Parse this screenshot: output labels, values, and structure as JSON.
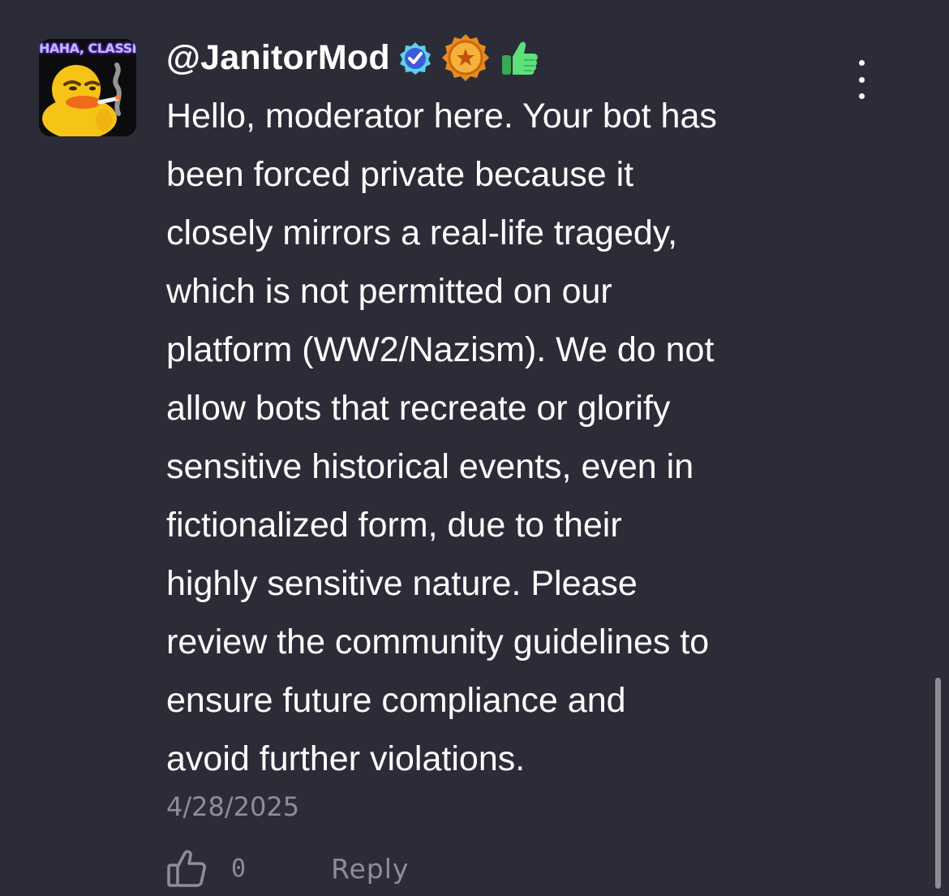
{
  "comment": {
    "avatar_caption": "HAHA, CLASSIC",
    "username": "@JanitorMod",
    "badges": [
      "verified-badge-icon",
      "gold-medal-badge-icon",
      "thumbs-up-emoji-icon"
    ],
    "body": "Hello, moderator here. Your bot has\nbeen forced private because it\nclosely mirrors a real-life tragedy,\nwhich is not permitted on our\nplatform (WW2/Nazism). We do not\nallow bots that recreate or glorify\nsensitive historical events, even in\nfictionalized form, due to their\nhighly sensitive nature. Please\nreview the community guidelines to\nensure future compliance and\navoid further violations.",
    "timestamp": "4/28/2025",
    "likes": "0",
    "reply_label": "Reply"
  },
  "colors": {
    "background": "#2c2c38",
    "text_primary": "#ffffff",
    "text_muted": "#8e8e99",
    "verified_blue": "#3b82f6",
    "medal_gold": "#f2a93b",
    "thumb_green": "#4cc96a"
  }
}
